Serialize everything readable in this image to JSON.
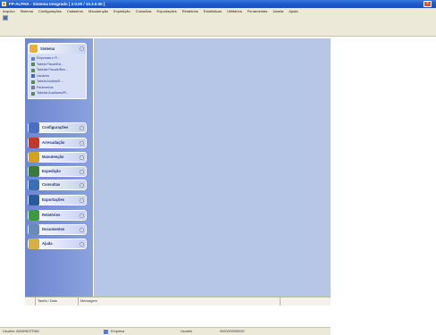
{
  "window": {
    "title": "FP-ALPHA - Sistema Integrado [ 2.0.00 / 10.3.0.00 ]",
    "close_glyph": "×"
  },
  "menu": [
    "Arquivo",
    "Sistema",
    "Configurações",
    "Cadastros",
    "Manutenção",
    "Expedição",
    "Consultas",
    "Exportações",
    "Relatórios",
    "Estatísticas",
    "Utilitários",
    "Ferramentas",
    "Janela",
    "Ajuda"
  ],
  "sidebar": {
    "main_panel": {
      "label": "Sistema",
      "icon": "folder-icon",
      "tasks": [
        {
          "label": "Empresas e Fi...",
          "icon": "company-icon"
        },
        {
          "label": "Tabela Fiscal/Est...",
          "icon": "table-icon"
        },
        {
          "label": "Tabelas Fiscais/Ben...",
          "icon": "table-icon"
        },
        {
          "label": "Usuários",
          "icon": "users-icon"
        },
        {
          "label": "Tabela Auxiliar/E...",
          "icon": "table-icon"
        },
        {
          "label": "Parâmetros",
          "icon": "settings-icon"
        },
        {
          "label": "Tabelas Auxiliares/Pl...",
          "icon": "table-icon"
        }
      ]
    },
    "groups": [
      {
        "label": "Configurações",
        "icon": "config-icon",
        "color": "#4a6fc0"
      },
      {
        "label": "Arrecadação",
        "icon": "arrecadacao-icon",
        "color": "#c0392b"
      },
      {
        "label": "Manutenção",
        "icon": "maintenance-icon",
        "color": "#d4a020"
      },
      {
        "label": "Expedição",
        "icon": "expedicao-icon",
        "color": "#3a7a3a"
      },
      {
        "label": "Consultas",
        "icon": "consultas-icon",
        "color": "#3a6fb0"
      },
      {
        "label": "Exportações",
        "icon": "exportacoes-icon",
        "color": "#2a5a9a"
      },
      {
        "label": "Relatórios",
        "icon": "relatorios-icon",
        "color": "#3f9a3f"
      },
      {
        "label": "Documentos",
        "icon": "documentos-icon",
        "color": "#6a8ab8"
      },
      {
        "label": "Ajuda",
        "icon": "help-icon",
        "color": "#d8b040"
      }
    ],
    "chevron_glyph": "«",
    "chevron_collapsed_glyph": "»"
  },
  "bottom_grid": {
    "columns": [
      "",
      "Tarefa / Data",
      "Mensagem",
      ""
    ]
  },
  "status": {
    "user_label": "Usuário: ADMINISTRAD",
    "company_label": "Empresa",
    "extra_label": "Usuário",
    "code_label": "00000/00000/00"
  },
  "colors": {
    "workspace": "#b5c6e6",
    "sidebar_gradient_start": "#6e86cf",
    "titlebar": "#1f5ccc"
  }
}
